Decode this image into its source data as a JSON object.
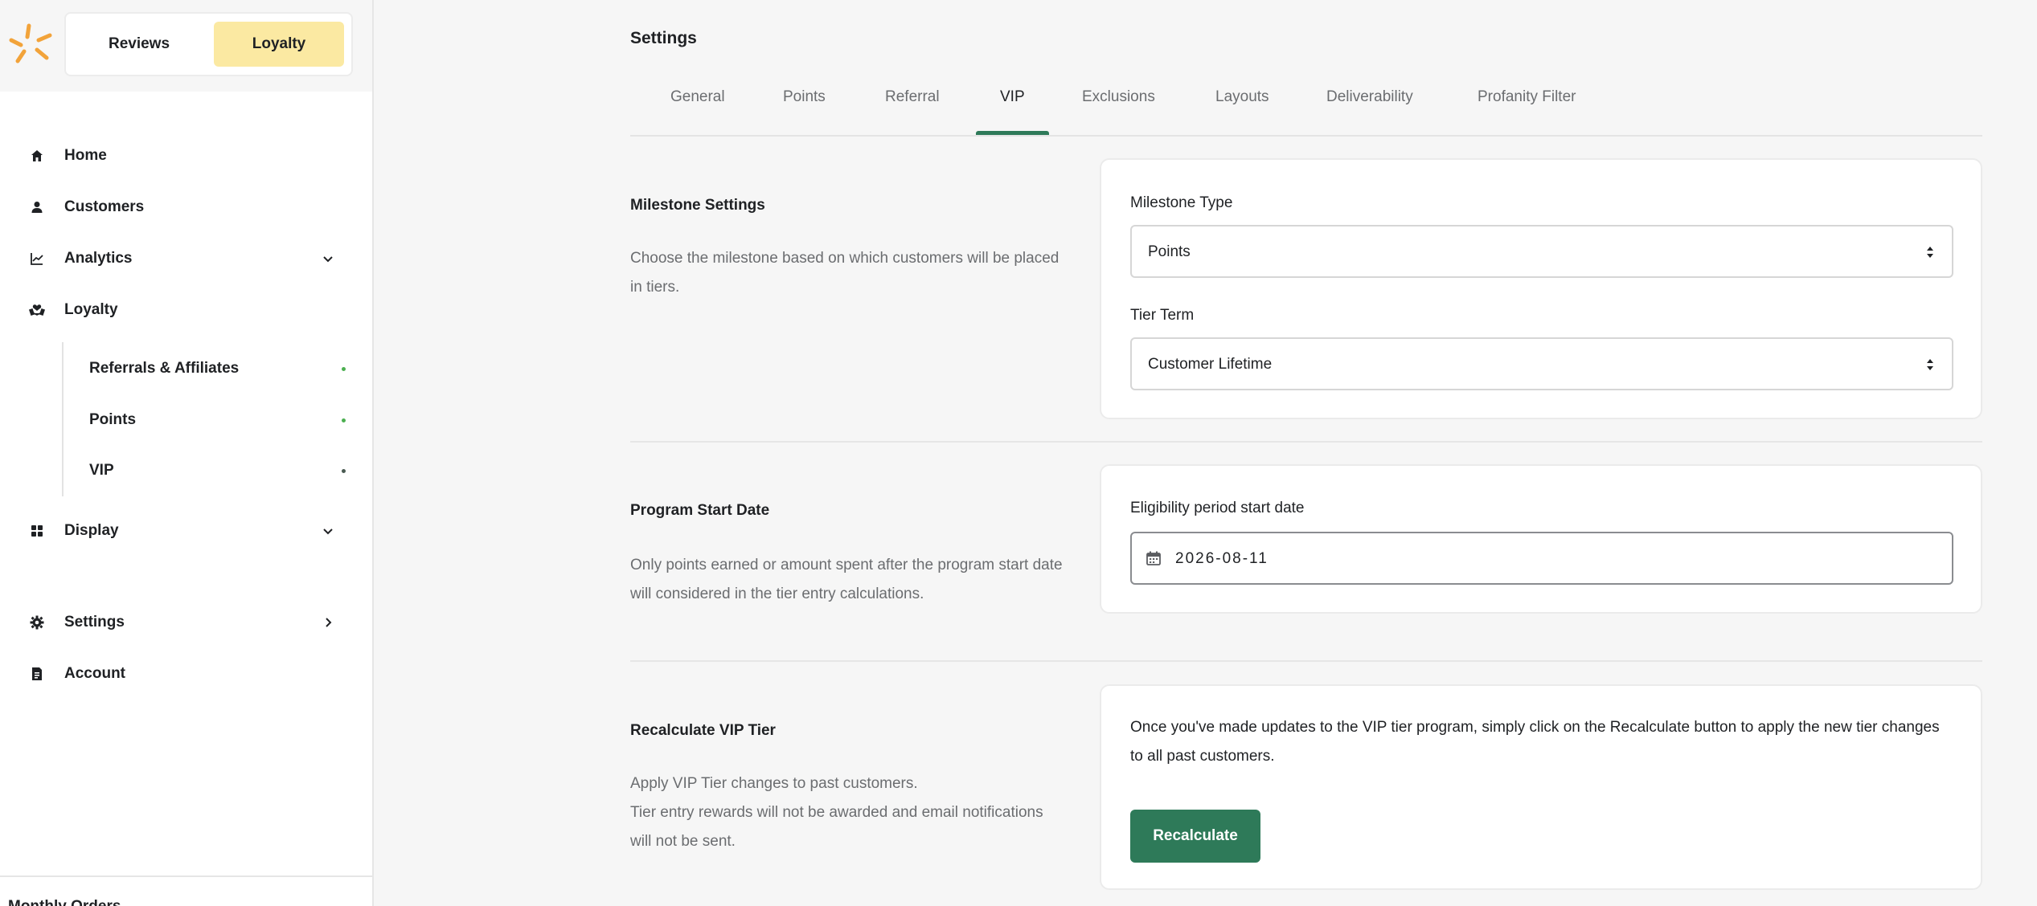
{
  "app_switch": {
    "reviews_label": "Reviews",
    "loyalty_label": "Loyalty"
  },
  "sidebar": {
    "items": [
      {
        "label": "Home",
        "icon": "home-icon"
      },
      {
        "label": "Customers",
        "icon": "user-icon"
      },
      {
        "label": "Analytics",
        "icon": "chart-icon"
      },
      {
        "label": "Loyalty",
        "icon": "loyalty-icon"
      },
      {
        "label": "Display",
        "icon": "grid-icon"
      },
      {
        "label": "Settings",
        "icon": "gear-icon"
      },
      {
        "label": "Account",
        "icon": "document-icon"
      }
    ],
    "loyalty_sub": [
      {
        "label": "Referrals & Affiliates",
        "dot_color": "#4caf50"
      },
      {
        "label": "Points",
        "dot_color": "#4caf50"
      },
      {
        "label": "VIP",
        "dot_color": "#4a5a52"
      }
    ],
    "cutoff_text": "Monthly Orders"
  },
  "main": {
    "title": "Settings",
    "tabs": [
      "General",
      "Points",
      "Referral",
      "VIP",
      "Exclusions",
      "Layouts",
      "Deliverability",
      "Profanity Filter"
    ],
    "active_tab": "VIP",
    "milestone": {
      "title": "Milestone Settings",
      "desc": "Choose the milestone based on which customers will be placed in tiers.",
      "type_label": "Milestone Type",
      "type_value": "Points",
      "term_label": "Tier Term",
      "term_value": "Customer Lifetime"
    },
    "start_date": {
      "title": "Program Start Date",
      "desc": "Only points earned or amount spent after the program start date will considered in the tier entry calculations.",
      "field_label": "Eligibility period start date",
      "value": "2026-08-11"
    },
    "recalculate": {
      "title": "Recalculate VIP Tier",
      "desc_line1": "Apply VIP Tier changes to past customers.",
      "desc_line2": "Tier entry rewards will not be awarded and email notifications will not be sent.",
      "card_text": "Once you've made updates to the VIP tier program, simply click on the Recalculate button to apply the new tier changes to all past customers.",
      "button_label": "Recalculate"
    }
  },
  "colors": {
    "accent": "#2e7a59",
    "loyalty_highlight": "#fbe9a2",
    "logo": "#f2a33a"
  }
}
